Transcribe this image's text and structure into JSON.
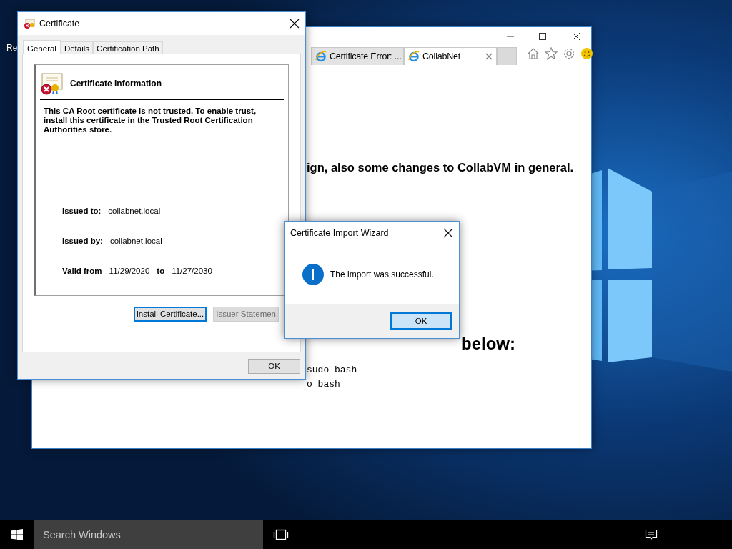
{
  "desktop": {
    "icons": [
      {
        "label": "Re"
      }
    ]
  },
  "browser": {
    "tabs": [
      {
        "title": "Certificate Error: ...",
        "selected": false
      },
      {
        "title": "CollabNet",
        "selected": true
      }
    ],
    "page": {
      "lines": [
        {
          "kind": "text",
          "text": "ign, also some changes to CollabVM in general."
        },
        {
          "kind": "heading",
          "text": "below:"
        },
        {
          "kind": "code",
          "text": "sudo bash"
        },
        {
          "kind": "code",
          "text": "o bash"
        }
      ]
    }
  },
  "certificate_dialog": {
    "title": "Certificate",
    "tabs": [
      {
        "label": "General",
        "selected": true
      },
      {
        "label": "Details",
        "selected": false
      },
      {
        "label": "Certification Path",
        "selected": false
      }
    ],
    "info_title": "Certificate Information",
    "message": "This CA Root certificate is not trusted. To enable trust, install this certificate in the Trusted Root Certification Authorities store.",
    "fields": [
      {
        "label": "Issued to:",
        "value": "collabnet.local"
      },
      {
        "label": "Issued by:",
        "value": "collabnet.local"
      }
    ],
    "validity": {
      "label": "Valid from",
      "from": "11/29/2020",
      "separator": "to",
      "to": "11/27/2030"
    },
    "buttons": [
      {
        "label": "Install Certificate...",
        "disabled": false,
        "focused": true
      },
      {
        "label": "Issuer Statemen",
        "disabled": true,
        "focused": false
      }
    ],
    "ok": "OK"
  },
  "wizard": {
    "title": "Certificate Import Wizard",
    "message": "The import was successful.",
    "button": "OK",
    "focused": true
  },
  "taskbar": {
    "search_placeholder": "Search Windows"
  }
}
